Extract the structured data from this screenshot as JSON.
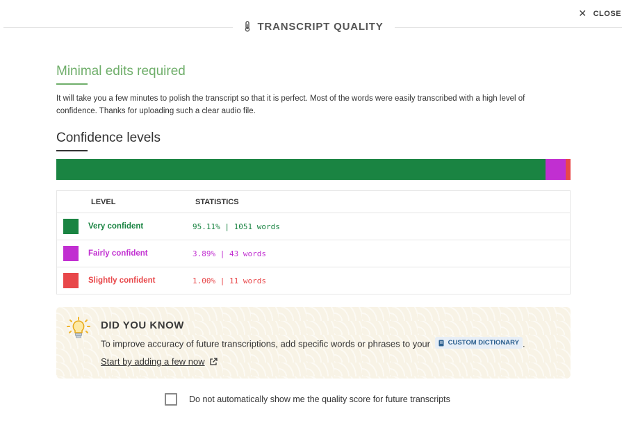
{
  "modal": {
    "title": "TRANSCRIPT QUALITY",
    "close_label": "CLOSE",
    "title_icon": "thermometer-icon",
    "close_icon": "close-icon"
  },
  "summary": {
    "heading": "Minimal edits required",
    "description": "It will take you a few minutes to polish the transcript so that it is perfect. Most of the words were easily transcribed with a high level of confidence. Thanks for uploading such a clear audio file."
  },
  "confidence": {
    "heading": "Confidence levels",
    "bar": [
      {
        "level": "Very confident",
        "percent": 95.11,
        "color": "#1a8442"
      },
      {
        "level": "Fairly confident",
        "percent": 3.89,
        "color": "#c12fd1"
      },
      {
        "level": "Slightly confident",
        "percent": 1.0,
        "color": "#e8474a"
      }
    ],
    "table": {
      "headers": [
        "LEVEL",
        "STATISTICS"
      ],
      "rows": [
        {
          "level": "Very confident",
          "stats": "95.11% | 1051 words",
          "color": "#1a8442"
        },
        {
          "level": "Fairly confident",
          "stats": "3.89% | 43 words",
          "color": "#c12fd1"
        },
        {
          "level": "Slightly confident",
          "stats": "1.00% | 11 words",
          "color": "#e8474a"
        }
      ]
    }
  },
  "did_you_know": {
    "title": "DID YOU KNOW",
    "text": "To improve accuracy of future transcriptions, add specific words or phrases to your",
    "chip_label": "CUSTOM DICTIONARY",
    "text_end": ".",
    "link_label": "Start by adding a few now",
    "icon": "lightbulb-icon",
    "chip_icon": "book-icon",
    "link_icon": "external-link-icon"
  },
  "preference": {
    "checkbox_label": "Do not automatically show me the quality score for future transcripts",
    "checked": false
  }
}
